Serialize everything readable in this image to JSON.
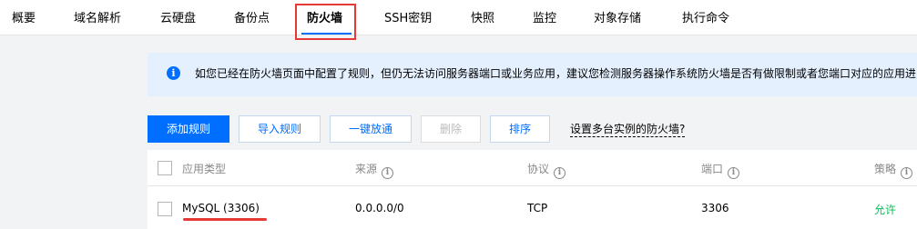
{
  "tabs": [
    {
      "label": "概要"
    },
    {
      "label": "域名解析"
    },
    {
      "label": "云硬盘"
    },
    {
      "label": "备份点"
    },
    {
      "label": "防火墙"
    },
    {
      "label": "SSH密钥"
    },
    {
      "label": "快照"
    },
    {
      "label": "监控"
    },
    {
      "label": "对象存储"
    },
    {
      "label": "执行命令"
    }
  ],
  "active_tab": "防火墙",
  "notice": {
    "icon": "info-icon",
    "text": "如您已经在防火墙页面中配置了规则，但仍无法访问服务器端口或业务应用，建议您检测服务器操作系统防火墙是否有做限制或者您端口对应的应用进"
  },
  "toolbar": {
    "add_rule": "添加规则",
    "import_rules": "导入规则",
    "one_click_allow": "一键放通",
    "delete": "删除",
    "sort": "排序",
    "multi_instance_help": "设置多台实例的防火墙?"
  },
  "table": {
    "headers": {
      "app_type": "应用类型",
      "source": "来源",
      "protocol": "协议",
      "port": "端口",
      "policy": "策略"
    },
    "rows": [
      {
        "app_type": "MySQL (3306)",
        "source": "0.0.0.0/0",
        "protocol": "TCP",
        "port": "3306",
        "policy": "允许"
      }
    ]
  },
  "colors": {
    "accent": "#006eff",
    "allow": "#0abf5b",
    "annotation": "#e53935"
  }
}
